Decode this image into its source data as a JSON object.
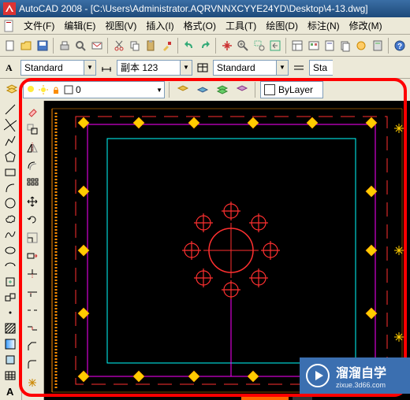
{
  "titlebar": {
    "text": "AutoCAD 2008 - [C:\\Users\\Administrator.AQRVNNXCYYE24YD\\Desktop\\4-13.dwg]"
  },
  "menu": {
    "file": "文件(F)",
    "edit": "编辑(E)",
    "view": "视图(V)",
    "insert": "插入(I)",
    "format": "格式(O)",
    "tools": "工具(T)",
    "draw": "绘图(D)",
    "dimension": "标注(N)",
    "modify": "修改(M)"
  },
  "stylebar": {
    "textstyle": "Standard",
    "dimstyle": "副本 123",
    "tablestyle": "Standard",
    "mlstyle": "Sta"
  },
  "layerbar": {
    "current": "0",
    "bylayer": "ByLayer"
  },
  "watermark": {
    "name": "溜溜自学",
    "url": "zixue.3d66.com"
  }
}
